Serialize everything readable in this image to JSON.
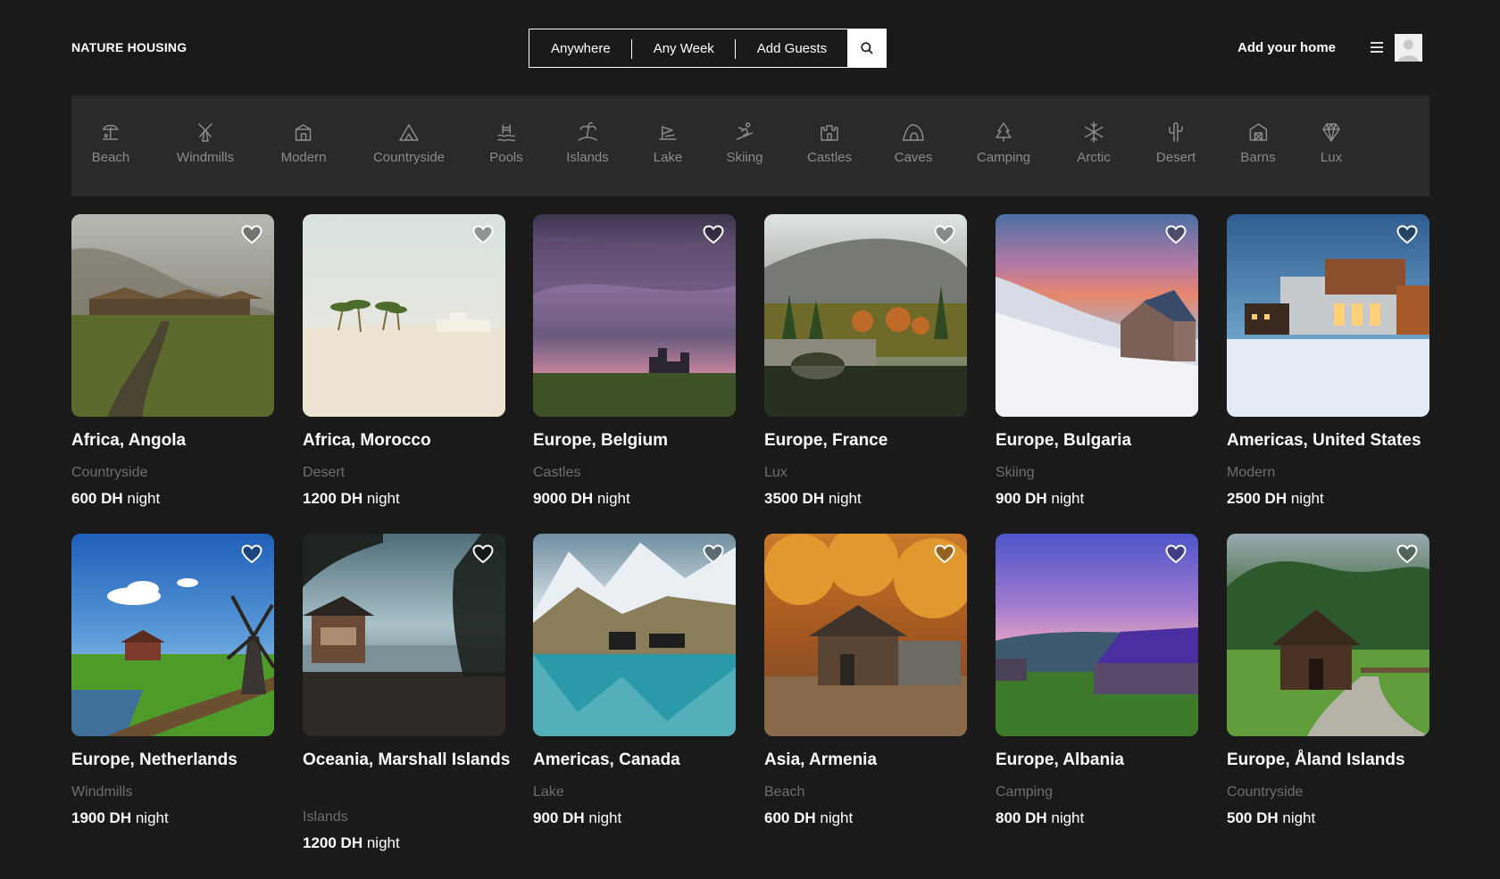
{
  "header": {
    "logo": "NATURE HOUSING",
    "search": {
      "where": "Anywhere",
      "when": "Any Week",
      "guests": "Add Guests"
    },
    "add_home": "Add your home"
  },
  "categories": [
    {
      "label": "Beach",
      "icon": "beach-icon"
    },
    {
      "label": "Windmills",
      "icon": "windmill-icon"
    },
    {
      "label": "Modern",
      "icon": "modern-house-icon"
    },
    {
      "label": "Countryside",
      "icon": "mountain-icon"
    },
    {
      "label": "Pools",
      "icon": "pool-icon"
    },
    {
      "label": "Islands",
      "icon": "island-icon"
    },
    {
      "label": "Lake",
      "icon": "lake-icon"
    },
    {
      "label": "Skiing",
      "icon": "skiing-icon"
    },
    {
      "label": "Castles",
      "icon": "castle-icon"
    },
    {
      "label": "Caves",
      "icon": "cave-icon"
    },
    {
      "label": "Camping",
      "icon": "tree-icon"
    },
    {
      "label": "Arctic",
      "icon": "snowflake-icon"
    },
    {
      "label": "Desert",
      "icon": "cactus-icon"
    },
    {
      "label": "Barns",
      "icon": "barn-icon"
    },
    {
      "label": "Lux",
      "icon": "diamond-icon"
    }
  ],
  "listings": [
    {
      "title": "Africa, Angola",
      "category": "Countryside",
      "price": "600 DH",
      "unit": "night"
    },
    {
      "title": "Africa, Morocco",
      "category": "Desert",
      "price": "1200 DH",
      "unit": "night"
    },
    {
      "title": "Europe, Belgium",
      "category": "Castles",
      "price": "9000 DH",
      "unit": "night"
    },
    {
      "title": "Europe, France",
      "category": "Lux",
      "price": "3500 DH",
      "unit": "night"
    },
    {
      "title": "Europe, Bulgaria",
      "category": "Skiing",
      "price": "900 DH",
      "unit": "night"
    },
    {
      "title": "Americas, United States",
      "category": "Modern",
      "price": "2500 DH",
      "unit": "night"
    },
    {
      "title": "Europe, Netherlands",
      "category": "Windmills",
      "price": "1900 DH",
      "unit": "night"
    },
    {
      "title": "Oceania, Marshall Islands",
      "category": "Islands",
      "price": "1200 DH",
      "unit": "night"
    },
    {
      "title": "Americas, Canada",
      "category": "Lake",
      "price": "900 DH",
      "unit": "night"
    },
    {
      "title": "Asia, Armenia",
      "category": "Beach",
      "price": "600 DH",
      "unit": "night"
    },
    {
      "title": "Europe, Albania",
      "category": "Camping",
      "price": "800 DH",
      "unit": "night"
    },
    {
      "title": "Europe, Åland Islands",
      "category": "Countryside",
      "price": "500 DH",
      "unit": "night"
    }
  ],
  "colors": {
    "background": "#1a1a1a",
    "category_bar": "#2a2a2a",
    "muted_text": "#6e6e6e",
    "category_text": "#8b8b8b"
  }
}
